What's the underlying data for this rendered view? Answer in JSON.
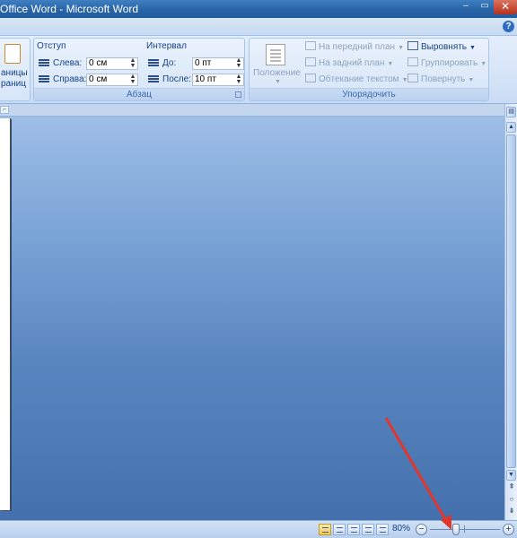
{
  "window": {
    "title": "Office Word - Microsoft Word",
    "minimize_glyph": "–",
    "maximize_glyph": "▭",
    "close_glyph": "✕"
  },
  "tabstrip": {
    "help_glyph": "?"
  },
  "ribbon": {
    "pages_group": {
      "label_line1": "аницы",
      "label_line2": "раниц"
    },
    "paragraph_group": {
      "label": "Абзац",
      "indent": {
        "title": "Отступ",
        "left_label": "Слева:",
        "left_value": "0 см",
        "right_label": "Справа:",
        "right_value": "0 см"
      },
      "spacing": {
        "title": "Интервал",
        "before_label": "До:",
        "before_value": "0 пт",
        "after_label": "После:",
        "after_value": "10 пт"
      }
    },
    "arrange_group": {
      "label": "Упорядочить",
      "position_label": "Положение",
      "bring_forward": "На передний план",
      "send_backward": "На задний план",
      "text_wrapping": "Обтекание текстом",
      "align": "Выровнять",
      "group": "Группировать",
      "rotate": "Повернуть"
    }
  },
  "statusbar": {
    "zoom_level": "80%",
    "zoom_minus": "−",
    "zoom_plus": "+",
    "zoom_fraction": 0.33
  },
  "colors": {
    "annotation_arrow": "#e0362b",
    "workspace_top": "#9ebee6",
    "workspace_bottom": "#4470ad",
    "active_view": "#f7c84d"
  }
}
